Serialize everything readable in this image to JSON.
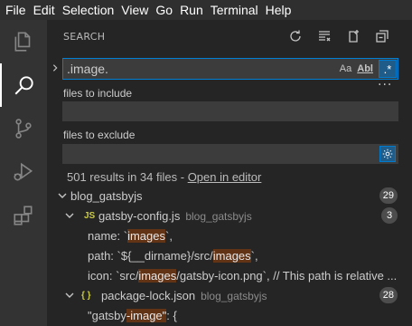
{
  "menu": [
    "File",
    "Edit",
    "Selection",
    "View",
    "Go",
    "Run",
    "Terminal",
    "Help"
  ],
  "activity_bar": [
    "explorer-icon",
    "search-icon",
    "source-control-icon",
    "run-debug-icon",
    "extensions-icon"
  ],
  "sidebar": {
    "title": "SEARCH",
    "header_actions": [
      "refresh-icon",
      "clear-results-icon",
      "new-search-editor-icon",
      "collapse-all-icon"
    ],
    "search": {
      "query": ".image.",
      "match_case": "Aa",
      "whole_word": "Abl",
      "regex": ".*"
    },
    "more_label": "···",
    "files_to_include": {
      "label": "files to include",
      "value": ""
    },
    "files_to_exclude": {
      "label": "files to exclude",
      "value": ""
    },
    "results_summary": "501 results in 34 files - ",
    "open_in_editor": "Open in editor",
    "tree": {
      "folder": {
        "name": "blog_gatsbyjs",
        "count": "29"
      },
      "file1": {
        "icon": "JS",
        "name": "gatsby-config.js",
        "path": "blog_gatsbyjs",
        "count": "3",
        "matches": [
          {
            "pre": "name: `",
            "hit": "images",
            "post": "`,"
          },
          {
            "pre": "path: `${__dirname}/src/",
            "hit": "images",
            "post": "`,"
          },
          {
            "pre": "icon: `src/",
            "hit": "images",
            "post": "/gatsby-icon.png`, // This path is relative ..."
          }
        ]
      },
      "file2": {
        "icon": "{ }",
        "name": "package-lock.json",
        "path": "blog_gatsbyjs",
        "count": "28",
        "matches": [
          {
            "pre": "\"gatsby",
            "hit": "-image\"",
            "post": ": {"
          }
        ]
      }
    }
  },
  "colors": {
    "accent": "#007fd4",
    "highlight": "#623315",
    "js_icon": "#cbcb41"
  }
}
